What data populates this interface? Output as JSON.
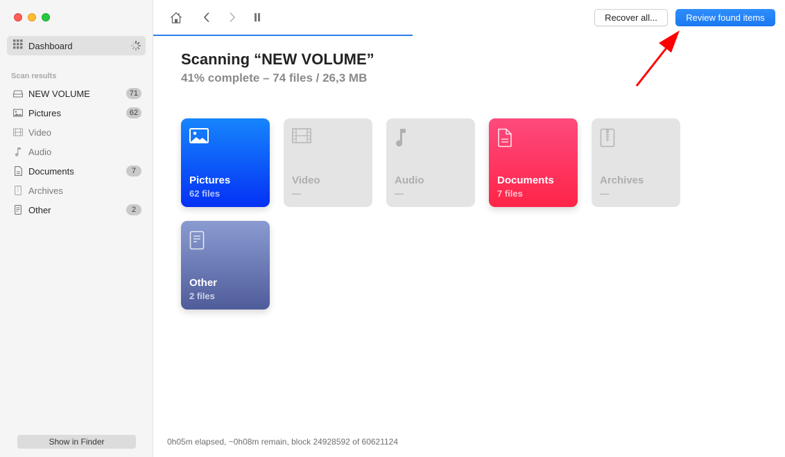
{
  "window": {
    "controls": [
      "close",
      "minimize",
      "zoom"
    ]
  },
  "sidebar": {
    "dashboard_label": "Dashboard",
    "section_label": "Scan results",
    "items": [
      {
        "label": "NEW VOLUME",
        "icon": "drive-icon",
        "count": "71",
        "dim": false
      },
      {
        "label": "Pictures",
        "icon": "picture-icon",
        "count": "62",
        "dim": false
      },
      {
        "label": "Video",
        "icon": "film-icon",
        "count": null,
        "dim": true
      },
      {
        "label": "Audio",
        "icon": "music-note-icon",
        "count": null,
        "dim": true
      },
      {
        "label": "Documents",
        "icon": "document-icon",
        "count": "7",
        "dim": false
      },
      {
        "label": "Archives",
        "icon": "archive-icon",
        "count": null,
        "dim": true
      },
      {
        "label": "Other",
        "icon": "file-icon",
        "count": "2",
        "dim": false
      }
    ],
    "show_in_finder_label": "Show in Finder"
  },
  "toolbar": {
    "icons": [
      "home-icon",
      "back-icon",
      "forward-icon",
      "pause-icon"
    ],
    "recover_all_label": "Recover all...",
    "review_label": "Review found items",
    "progress_fraction": 0.41
  },
  "scan": {
    "title": "Scanning “NEW VOLUME”",
    "subtitle": "41% complete – 74 files / 26,3 MB"
  },
  "tiles": [
    {
      "name": "Pictures",
      "count": "62 files",
      "active": true,
      "color": "#0a5cf8"
    },
    {
      "name": "Video",
      "count": "—",
      "active": false
    },
    {
      "name": "Audio",
      "count": "—",
      "active": false
    },
    {
      "name": "Documents",
      "count": "7 files",
      "active": true,
      "color": "#fe3662"
    },
    {
      "name": "Archives",
      "count": "—",
      "active": false
    },
    {
      "name": "Other",
      "count": "2 files",
      "active": true,
      "color": "#6d7bb8"
    }
  ],
  "status_text": "0h05m elapsed, ~0h08m remain, block 24928592 of 60621124",
  "colors": {
    "accent": "#1a78f2",
    "annotation_arrow": "#ff0000"
  }
}
